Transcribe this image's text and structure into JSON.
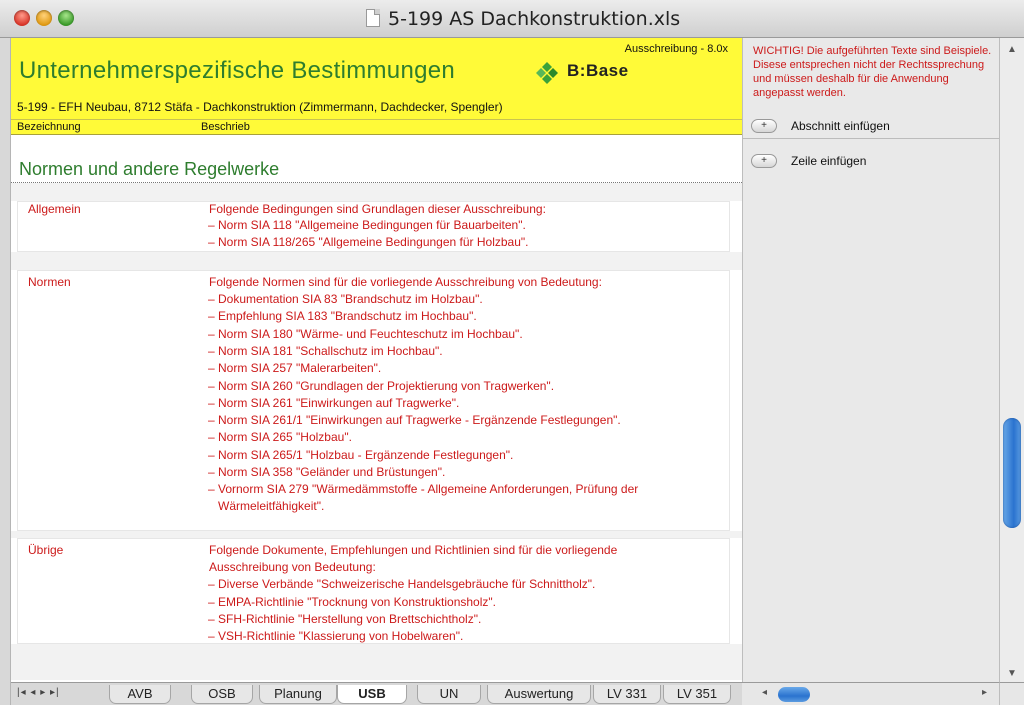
{
  "window": {
    "title": "5-199 AS Dachkonstruktion.xls"
  },
  "header": {
    "title": "Unternehmerspezifische Bestimmungen",
    "version": "Ausschreibung - 8.0x",
    "logo_text": "B:Base",
    "project": "5-199 - EFH Neubau, 8712 Stäfa  - Dachkonstruktion (Zimmermann, Dachdecker, Spengler)",
    "col_bezeichnung": "Bezeichnung",
    "col_beschrieb": "Beschrieb",
    "brand_color": "#fffa38",
    "title_color": "#2e7d2e"
  },
  "section": {
    "title": "Normen und andere Regelwerke"
  },
  "blocks": {
    "allgemein": {
      "label": "Allgemein",
      "intro": "Folgende Bedingungen sind Grundlagen dieser Ausschreibung:",
      "items": [
        "Norm SIA 118 \"Allgemeine Bedingungen für Bauarbeiten\".",
        "Norm SIA 118/265 \"Allgemeine Bedingungen für Holzbau\"."
      ]
    },
    "normen": {
      "label": "Normen",
      "intro": "Folgende Normen sind für die vorliegende Ausschreibung von Bedeutung:",
      "items": [
        "Dokumentation SIA 83 \"Brandschutz im Holzbau\".",
        "Empfehlung SIA 183 \"Brandschutz im Hochbau\".",
        "Norm SIA 180 \"Wärme- und Feuchteschutz im Hochbau\".",
        "Norm SIA 181 \"Schallschutz im Hochbau\".",
        "Norm SIA 257 \"Malerarbeiten\".",
        "Norm SIA 260 \"Grundlagen der Projektierung von Tragwerken\".",
        "Norm SIA 261 \"Einwirkungen auf Tragwerke\".",
        "Norm SIA 261/1 \"Einwirkungen auf Tragwerke - Ergänzende Festlegungen\".",
        "Norm SIA 265 \"Holzbau\".",
        "Norm SIA 265/1 \"Holzbau - Ergänzende Festlegungen\".",
        "Norm SIA 358 \"Geländer und Brüstungen\".",
        "Vornorm SIA 279 \"Wärmedämmstoffe - Allgemeine Anforderungen, Prüfung der",
        "Wärmeleitfähigkeit\"."
      ]
    },
    "uebrige": {
      "label": "Übrige",
      "intro1": "Folgende Dokumente, Empfehlungen und Richtlinien sind für die vorliegende",
      "intro2": "Ausschreibung von Bedeutung:",
      "items": [
        "Diverse Verbände \"Schweizerische Handelsgebräuche für Schnittholz\".",
        "EMPA-Richtlinie \"Trocknung von Konstruktionsholz\".",
        "SFH-Richtlinie \"Herstellung von Brettschichtholz\".",
        "VSH-Richtlinie \"Klassierung von Hobelwaren\"."
      ]
    }
  },
  "panel": {
    "warning": "WICHTIG! Die aufgeführten Texte sind Beispiele. Disese entsprechen nicht der Rechtssprechung und müssen deshalb für die Anwendung angepasst werden.",
    "btn_symbol": "+",
    "abschnitt_label": "Abschnitt einfügen",
    "zeile_label": "Zeile einfügen"
  },
  "tabs": [
    "AVB",
    "OSB",
    "Planung",
    "USB",
    "UN",
    "Auswertung",
    "LV 331",
    "LV 351"
  ],
  "active_tab": "USB",
  "nav": "|◂ ◂ ▸ ▸|"
}
